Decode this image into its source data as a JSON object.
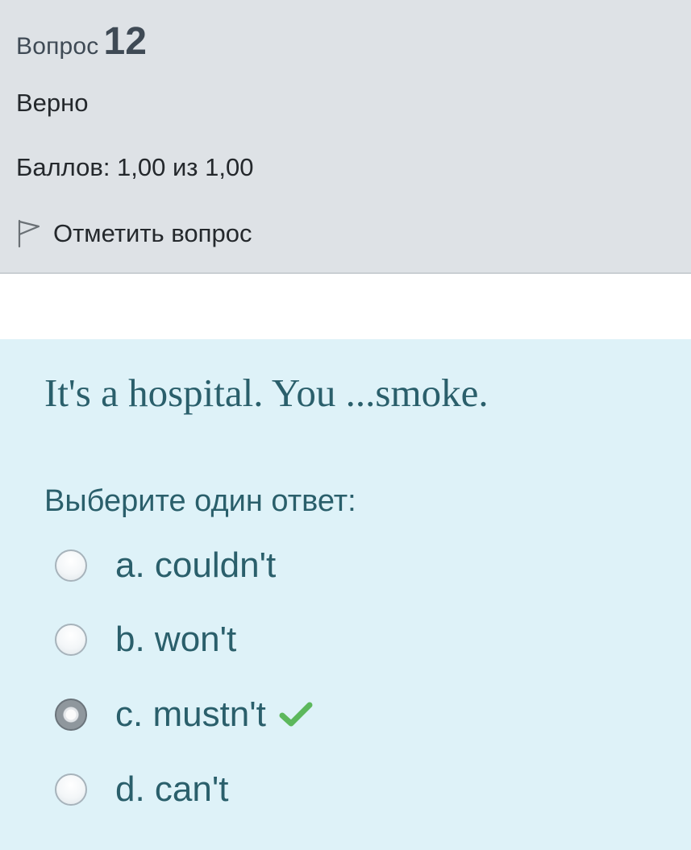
{
  "info": {
    "question_word": "Вопрос",
    "question_number": "12",
    "state": "Верно",
    "grade": "Баллов: 1,00 из 1,00",
    "flag_label": "Отметить вопрос",
    "flag_icon": "flag-outline-icon"
  },
  "question": {
    "text": "It's a hospital. You ...smoke.",
    "prompt": "Выберите один ответ:",
    "answers": [
      {
        "label": "a. couldn't",
        "selected": false
      },
      {
        "label": "b. won't",
        "selected": false
      },
      {
        "label": "c. mustn't",
        "selected": true,
        "correct": true,
        "icon": "checkmark-icon"
      },
      {
        "label": "d. can't",
        "selected": false
      }
    ]
  },
  "colors": {
    "info_background": "#dee2e6",
    "content_background": "#def2f8",
    "content_text": "#2a5f6b",
    "correct_check": "#5cb85c"
  }
}
